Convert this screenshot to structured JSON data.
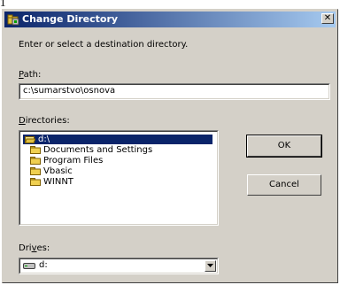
{
  "page_marker": "1",
  "window": {
    "title": "Change Directory",
    "app_icon": "folder-app-icon",
    "close_glyph": "✕"
  },
  "instructions": "Enter or select a destination directory.",
  "path": {
    "label_prefix": "",
    "label_underlined": "P",
    "label_rest": "ath:",
    "value": "c:\\sumarstvo\\osnova"
  },
  "directories": {
    "label_underlined": "D",
    "label_rest": "irectories:",
    "items": [
      {
        "name": "d:\\",
        "icon": "open-folder-icon",
        "selected": true
      },
      {
        "name": "Documents and Settings",
        "icon": "folder-icon",
        "selected": false
      },
      {
        "name": "Program Files",
        "icon": "folder-icon",
        "selected": false
      },
      {
        "name": "Vbasic",
        "icon": "folder-icon",
        "selected": false
      },
      {
        "name": "WINNT",
        "icon": "folder-icon",
        "selected": false
      }
    ]
  },
  "buttons": {
    "ok": "OK",
    "cancel": "Cancel"
  },
  "drives": {
    "label_prefix": "Dri",
    "label_underlined": "v",
    "label_rest": "es:",
    "selected": "d:",
    "icon": "drive-icon"
  },
  "colors": {
    "title_start": "#0a246a",
    "title_end": "#a6caf0",
    "face": "#d4d0c8",
    "selection": "#0a246a"
  }
}
